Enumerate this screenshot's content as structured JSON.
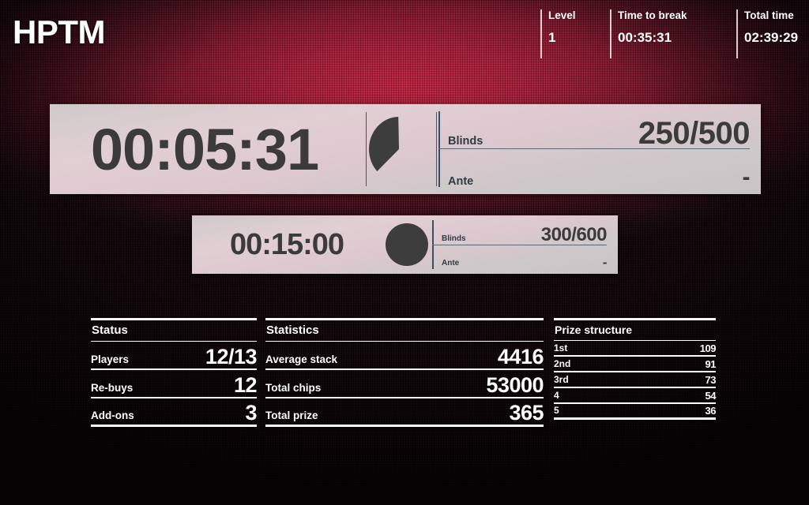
{
  "app": {
    "logo": "HPTM"
  },
  "header": {
    "stats": [
      {
        "label": "Level",
        "value": "1"
      },
      {
        "label": "Time to break",
        "value": "00:35:31"
      },
      {
        "label": "Total time",
        "value": "02:39:29"
      }
    ]
  },
  "current_level": {
    "clock": "00:05:31",
    "progress_percent": 63,
    "blinds_label": "Blinds",
    "blinds_value": "250/500",
    "ante_label": "Ante",
    "ante_value": "-"
  },
  "next_level": {
    "clock": "00:15:00",
    "progress_percent": 100,
    "blinds_label": "Blinds",
    "blinds_value": "300/600",
    "ante_label": "Ante",
    "ante_value": "-"
  },
  "tables": {
    "status": {
      "title": "Status",
      "rows": [
        {
          "label": "Players",
          "value": "12/13"
        },
        {
          "label": "Re-buys",
          "value": "12"
        },
        {
          "label": "Add-ons",
          "value": "3"
        }
      ]
    },
    "statistics": {
      "title": "Statistics",
      "rows": [
        {
          "label": "Average stack",
          "value": "4416"
        },
        {
          "label": "Total chips",
          "value": "53000"
        },
        {
          "label": "Total prize",
          "value": "365"
        }
      ]
    },
    "prize_structure": {
      "title": "Prize structure",
      "rows": [
        {
          "label": "1st",
          "value": "109"
        },
        {
          "label": "2nd",
          "value": "91"
        },
        {
          "label": "3rd",
          "value": "73"
        },
        {
          "label": "4",
          "value": "54"
        },
        {
          "label": "5",
          "value": "36"
        }
      ]
    }
  },
  "colors": {
    "background_center": "#c0203f",
    "background_edge": "#0c0206",
    "panel_face": "#dcc8ce",
    "panel_text": "#3b3b3b",
    "pie_fill": "#3d3d3d",
    "text_primary": "#ffffff",
    "rule_blue": "#39505f"
  }
}
